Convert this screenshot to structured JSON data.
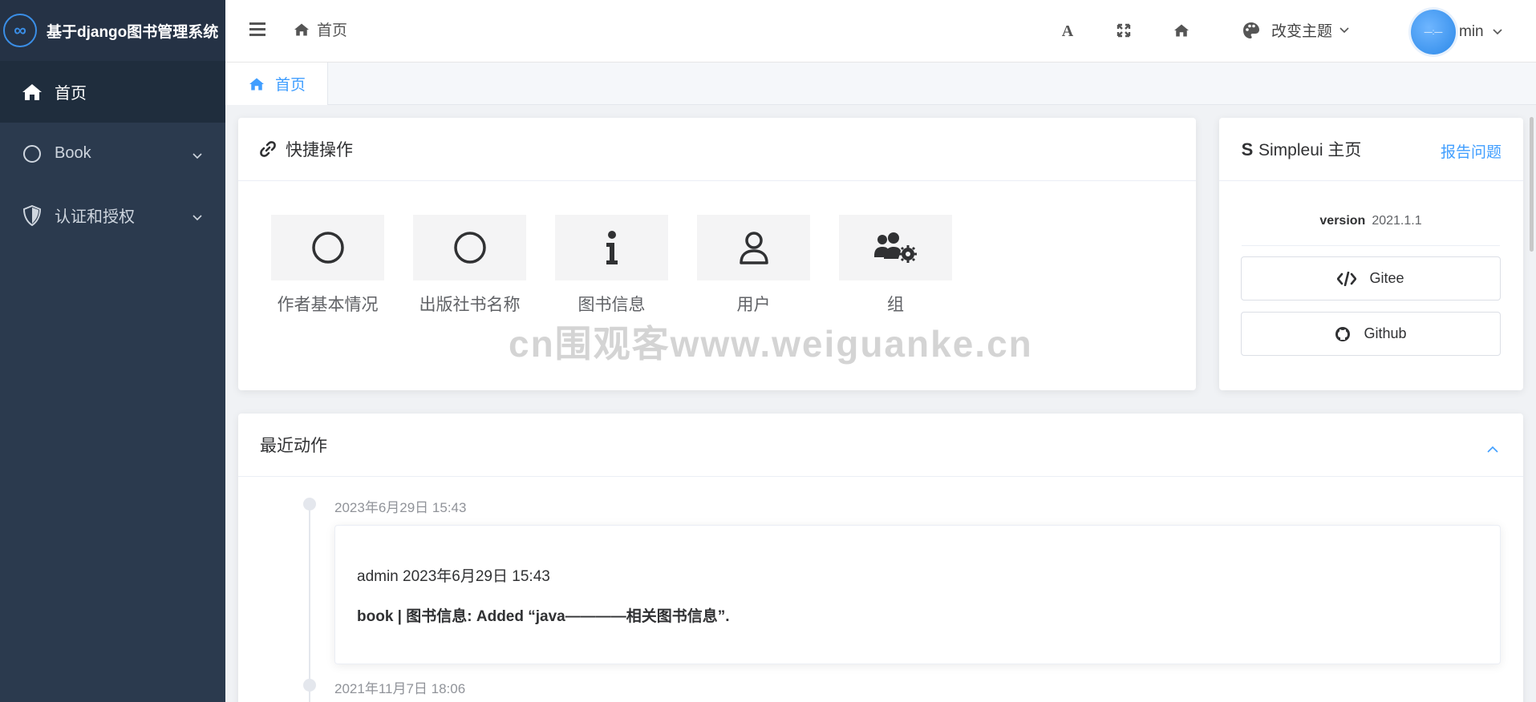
{
  "brand": {
    "title": "基于django图书管理系统",
    "logo_icon": "infinity-logo-icon"
  },
  "sidebar": {
    "items": [
      {
        "label": "首页",
        "icon": "home-icon",
        "active": true
      },
      {
        "label": "Book",
        "icon": "circle-icon",
        "expandable": true
      },
      {
        "label": "认证和授权",
        "icon": "shield-icon",
        "expandable": true
      }
    ]
  },
  "header": {
    "breadcrumb": "首页",
    "theme_label": "改变主题",
    "user_name": "min",
    "avatar_text": "—:—"
  },
  "tabs": [
    {
      "label": "首页"
    }
  ],
  "quick_actions": {
    "title": "快捷操作",
    "items": [
      {
        "label": "作者基本情况",
        "icon": "circle-icon"
      },
      {
        "label": "出版社书名称",
        "icon": "circle-icon"
      },
      {
        "label": "图书信息",
        "icon": "info-icon"
      },
      {
        "label": "用户",
        "icon": "user-icon"
      },
      {
        "label": "组",
        "icon": "users-cog-icon"
      }
    ]
  },
  "simpleui": {
    "title": "Simpleui 主页",
    "report_label": "报告问题",
    "version_label": "version",
    "version_value": "2021.1.1",
    "gitee_label": "Gitee",
    "github_label": "Github"
  },
  "recent": {
    "title": "最近动作",
    "entries": [
      {
        "time": "2023年6月29日 15:43",
        "meta": "admin 2023年6月29日 15:43",
        "desc": "book | 图书信息: Added “java————相关图书信息”."
      },
      {
        "time": "2021年11月7日 18:06"
      }
    ]
  },
  "watermark": "cn围观客www.weiguanke.cn",
  "colors": {
    "sidebar": "#2b3a4e",
    "accent": "#409eff"
  }
}
